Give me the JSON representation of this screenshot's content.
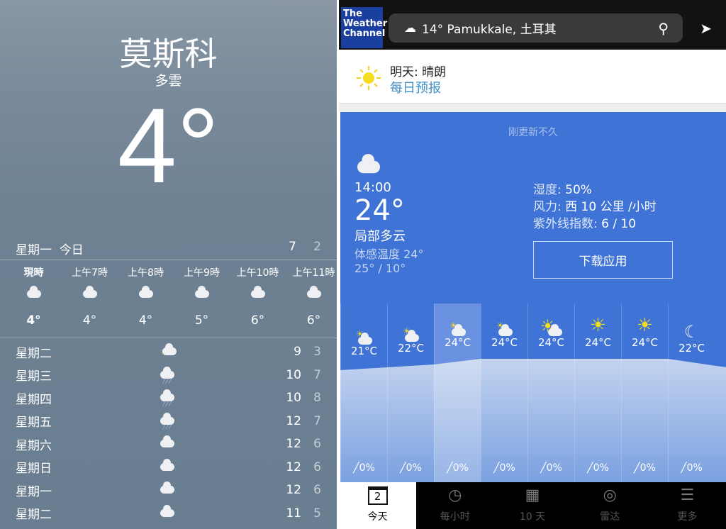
{
  "left": {
    "city": "莫斯科",
    "condition": "多雲",
    "temp": "4°",
    "today": {
      "day": "星期一",
      "label": "今日",
      "high": "7",
      "low": "2"
    },
    "hourly": [
      {
        "time": "現時",
        "temp": "4°",
        "icon": "cloud-icon"
      },
      {
        "time": "上午7時",
        "temp": "4°",
        "icon": "cloud-icon"
      },
      {
        "time": "上午8時",
        "temp": "4°",
        "icon": "cloud-icon"
      },
      {
        "time": "上午9時",
        "temp": "5°",
        "icon": "cloud-icon"
      },
      {
        "time": "上午10時",
        "temp": "6°",
        "icon": "cloud-icon"
      },
      {
        "time": "上午11時",
        "temp": "6°",
        "icon": "cloud-icon"
      }
    ],
    "daily": [
      {
        "day": "星期二",
        "icon": "partly-sunny-icon",
        "high": "9",
        "low": "3"
      },
      {
        "day": "星期三",
        "icon": "rain-icon",
        "high": "10",
        "low": "7"
      },
      {
        "day": "星期四",
        "icon": "rain-icon",
        "high": "10",
        "low": "8"
      },
      {
        "day": "星期五",
        "icon": "rain-icon",
        "high": "12",
        "low": "7"
      },
      {
        "day": "星期六",
        "icon": "cloud-icon",
        "high": "12",
        "low": "6"
      },
      {
        "day": "星期日",
        "icon": "cloud-icon",
        "high": "12",
        "low": "6"
      },
      {
        "day": "星期一",
        "icon": "cloud-icon",
        "high": "12",
        "low": "6"
      },
      {
        "day": "星期二",
        "icon": "cloud-icon",
        "high": "11",
        "low": "5"
      }
    ]
  },
  "right": {
    "logo": "The Weather Channel",
    "search": "14° Pamukkale, 土耳其",
    "tomorrow": {
      "label": "明天: 晴朗",
      "link": "每日预报"
    },
    "updated": "刚更新不久",
    "now": {
      "time": "14:00",
      "temp": "24°",
      "desc": "局部多云",
      "feels": "体感温度 24°",
      "range": "25° / 10°"
    },
    "stats": {
      "humidity_label": "湿度: ",
      "humidity": "50%",
      "wind_label": "风力: ",
      "wind": "西 10 公里 /小时",
      "uv_label": "紫外线指数: ",
      "uv": "6 / 10"
    },
    "download": "下载应用",
    "forecast": [
      {
        "temp": "21°C",
        "icon": "partly-cloudy-icon",
        "precip": "0%"
      },
      {
        "temp": "22°C",
        "icon": "partly-cloudy-icon",
        "precip": "0%"
      },
      {
        "temp": "24°C",
        "icon": "partly-cloudy-icon",
        "precip": "0%"
      },
      {
        "temp": "24°C",
        "icon": "partly-cloudy-icon",
        "precip": "0%"
      },
      {
        "temp": "24°C",
        "icon": "mostly-sunny-icon",
        "precip": "0%"
      },
      {
        "temp": "24°C",
        "icon": "sun-icon",
        "precip": "0%"
      },
      {
        "temp": "24°C",
        "icon": "sun-icon",
        "precip": "0%"
      },
      {
        "temp": "22°C",
        "icon": "moon-icon",
        "precip": "0%"
      }
    ],
    "tabs": [
      {
        "label": "今天",
        "icon": "calendar-day-icon",
        "glyph": "2"
      },
      {
        "label": "每小时",
        "icon": "clock-icon",
        "glyph": "◷"
      },
      {
        "label": "10 天",
        "icon": "calendar-grid-icon",
        "glyph": "▦"
      },
      {
        "label": "雷达",
        "icon": "radar-icon",
        "glyph": "◎"
      },
      {
        "label": "更多",
        "icon": "menu-icon",
        "glyph": "☰"
      }
    ]
  }
}
